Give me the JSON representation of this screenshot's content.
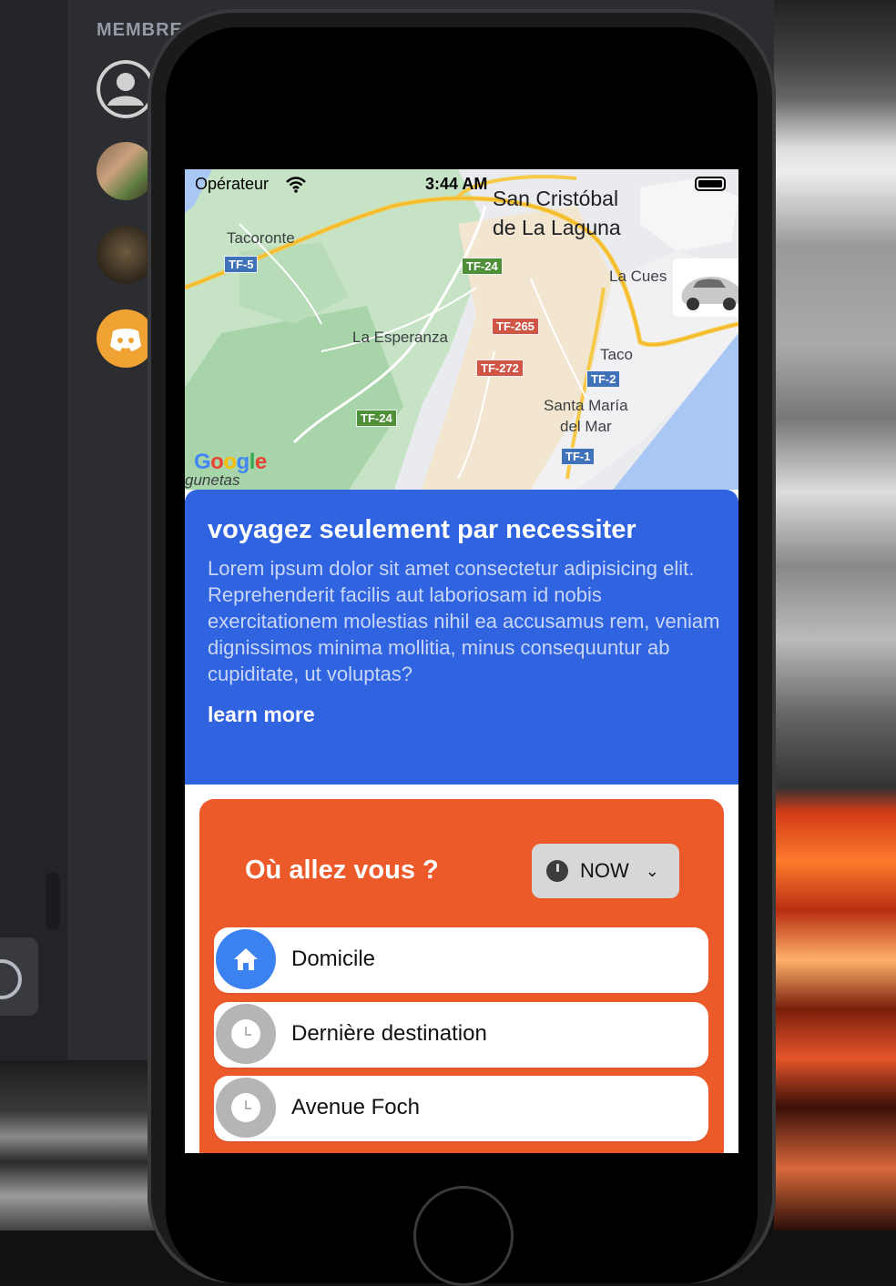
{
  "background": {
    "members_label": "MEMBRE"
  },
  "status_bar": {
    "operator": "Opérateur",
    "time": "3:44 AM"
  },
  "map": {
    "places": {
      "san_cristobal_line1": "San Cristóbal",
      "san_cristobal_line2": "de La Laguna",
      "tacoronte": "Tacoronte",
      "la_cuesta": "La Cues",
      "la_esperanza": "La Esperanza",
      "taco": "Taco",
      "santa_maria_line1": "Santa María",
      "santa_maria_line2": "del Mar",
      "lagunetas": "gunetas"
    },
    "roads": {
      "tf5": "TF-5",
      "tf24_a": "TF-24",
      "tf24_b": "TF-24",
      "tf265": "TF-265",
      "tf272": "TF-272",
      "tf2": "TF-2",
      "tf1": "TF-1"
    },
    "attribution": "Google"
  },
  "info_card": {
    "title": "voyagez seulement par necessiter",
    "body": "Lorem ipsum dolor sit amet consectetur adipisicing elit. Reprehenderit facilis aut laboriosam id nobis exercitationem molestias nihil ea accusamus rem, veniam dignissimos minima mollitia, minus consequuntur ab cupiditate, ut voluptas?",
    "link": "learn more",
    "color": "#2f63e0"
  },
  "destination_card": {
    "title": "Où allez vous ?",
    "time_selector": "NOW",
    "color": "#ec5a2a",
    "items": [
      {
        "label": "Domicile",
        "icon": "home-icon"
      },
      {
        "label": "Dernière destination",
        "icon": "clock-icon"
      },
      {
        "label": "Avenue Foch",
        "icon": "clock-icon"
      }
    ]
  }
}
